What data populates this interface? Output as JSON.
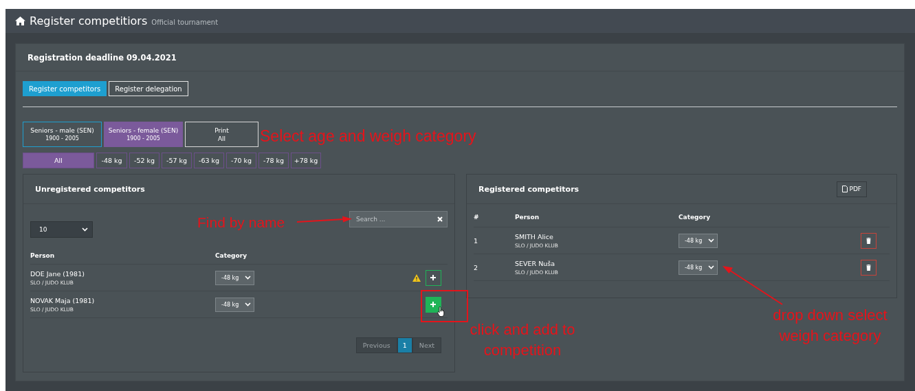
{
  "header": {
    "title": "Register competitiors",
    "subtitle": "Official tournament"
  },
  "deadline": "Registration deadline 09.04.2021",
  "tabs": [
    {
      "label": "Register competitors",
      "selected": true
    },
    {
      "label": "Register delegation",
      "selected": false
    }
  ],
  "age_categories": [
    {
      "label": "Seniors - male (SEN)",
      "years": "1900 - 2005",
      "selected": false
    },
    {
      "label": "Seniors - female (SEN)",
      "years": "1900 - 2005",
      "selected": true
    }
  ],
  "print_button": {
    "label": "Print",
    "value": "All"
  },
  "weight_categories": [
    {
      "label": "All",
      "selected": true
    },
    {
      "label": "-48 kg",
      "selected": false
    },
    {
      "label": "-52 kg",
      "selected": false
    },
    {
      "label": "-57 kg",
      "selected": false
    },
    {
      "label": "-63 kg",
      "selected": false
    },
    {
      "label": "-70 kg",
      "selected": false
    },
    {
      "label": "-78 kg",
      "selected": false
    },
    {
      "label": "+78 kg",
      "selected": false
    }
  ],
  "unregistered": {
    "title": "Unregistered competitors",
    "page_size": "10",
    "search": {
      "placeholder": "Search ..."
    },
    "columns": [
      "Person",
      "Category"
    ],
    "rows": [
      {
        "name": "DOE Jane (1981)",
        "club": "SLO / JUDO KLUB",
        "category": "-48 kg",
        "warning": true,
        "hovered": false
      },
      {
        "name": "NOVAK Maja (1981)",
        "club": "SLO / JUDO KLUB",
        "category": "-48 kg",
        "warning": false,
        "hovered": true
      }
    ],
    "pagination": {
      "previous": "Previous",
      "pages": [
        {
          "label": "1",
          "selected": true
        }
      ],
      "next": "Next"
    }
  },
  "registered": {
    "title": "Registered competitors",
    "pdf": "PDF",
    "columns": [
      "#",
      "Person",
      "Category"
    ],
    "rows": [
      {
        "number": "1",
        "name": "SMITH Alice",
        "club": "SLO / JUDO KLUB",
        "category": "-48 kg"
      },
      {
        "number": "2",
        "name": "SEVER Nuša",
        "club": "SLO / JUDO KLUB",
        "category": "-48 kg"
      }
    ]
  },
  "annotations": [
    {
      "text": "Select age and weigh category"
    },
    {
      "text": "Find by name"
    },
    {
      "text": "click and add to competition"
    },
    {
      "text": "drop down select weigh category"
    }
  ]
}
